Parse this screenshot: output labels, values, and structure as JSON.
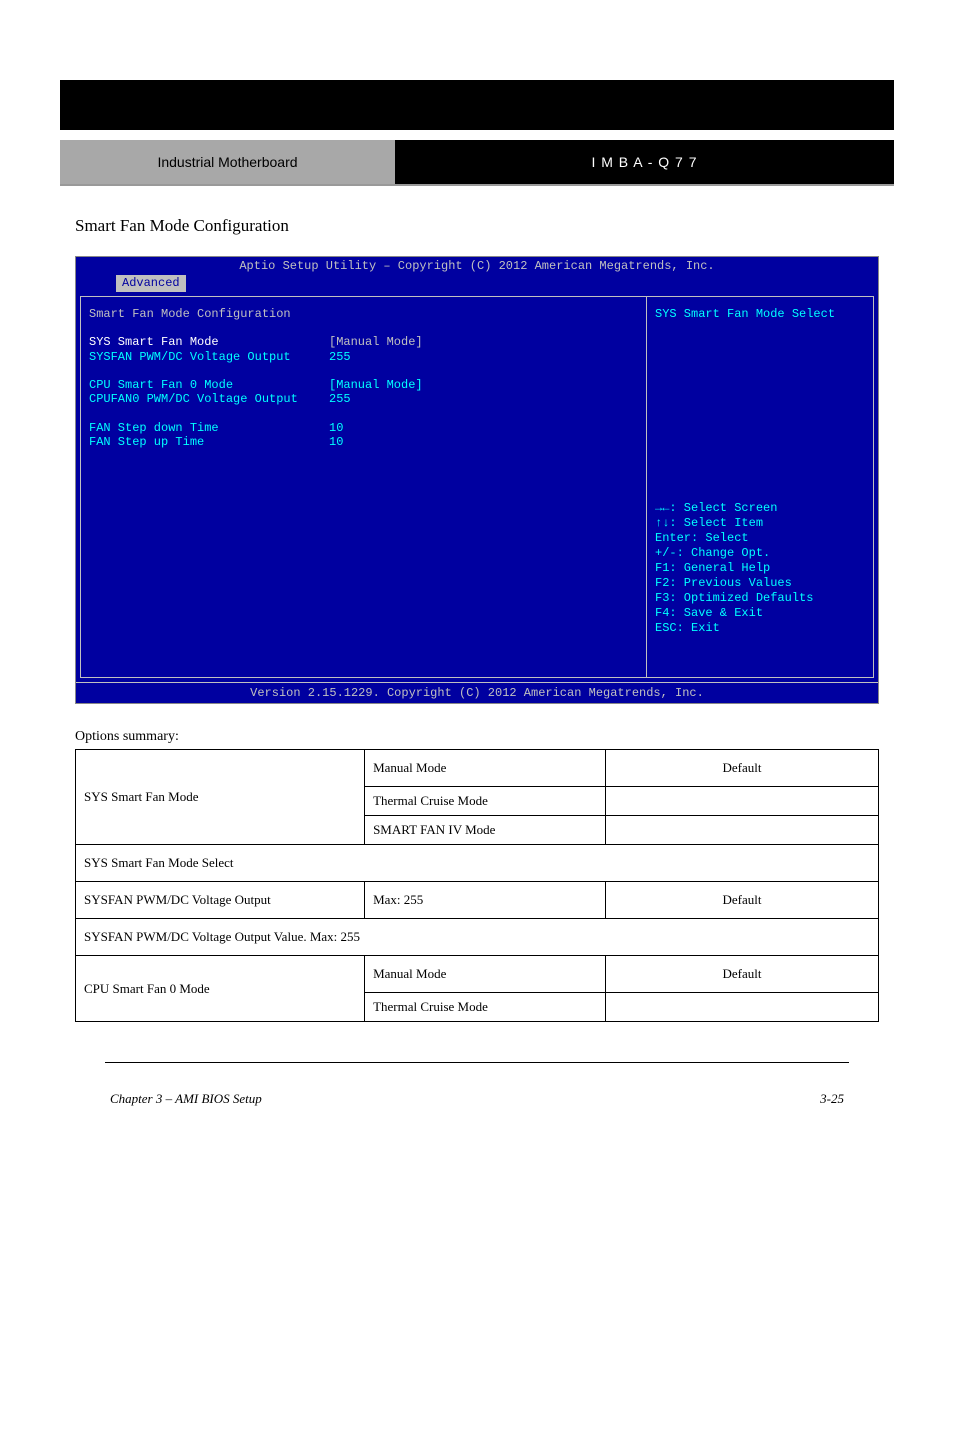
{
  "header": {
    "left": "Industrial Motherboard",
    "right_code": "I M B A - Q 7 7"
  },
  "section_title": "Smart Fan Mode Configuration",
  "bios": {
    "top_bar": "Aptio Setup Utility – Copyright (C) 2012 American Megatrends, Inc.",
    "tab": "Advanced",
    "main_heading": "Smart Fan Mode Configuration",
    "rows": [
      {
        "label": "SYS Smart Fan Mode",
        "value": "[Manual Mode]",
        "label_class": "white",
        "value_class": ""
      },
      {
        "label": "SYSFAN PWM/DC Voltage Output",
        "value": "255",
        "label_class": "cyan",
        "value_class": "cyan"
      },
      {
        "spacer": true
      },
      {
        "label": "CPU Smart Fan 0 Mode",
        "value": "[Manual Mode]",
        "label_class": "cyan",
        "value_class": "cyan"
      },
      {
        "label": "CPUFAN0 PWM/DC Voltage Output",
        "value": "255",
        "label_class": "cyan",
        "value_class": "cyan"
      },
      {
        "spacer": true
      },
      {
        "label": "FAN Step down Time",
        "value": "10",
        "label_class": "cyan",
        "value_class": "cyan"
      },
      {
        "label": "FAN Step up Time",
        "value": "10",
        "label_class": "cyan",
        "value_class": "cyan"
      }
    ],
    "side_desc": "SYS Smart Fan Mode Select",
    "help": [
      "→←: Select Screen",
      "↑↓: Select Item",
      "Enter: Select",
      "+/-: Change Opt.",
      "F1: General Help",
      "F2: Previous Values",
      "F3: Optimized Defaults",
      "F4: Save & Exit",
      "ESC: Exit"
    ],
    "bottom_bar": "Version 2.15.1229. Copyright (C) 2012 American Megatrends, Inc."
  },
  "options_label": "Options summary:",
  "table": {
    "block1": {
      "setting": "SYS Smart Fan Mode",
      "rows": [
        {
          "option": "Manual Mode",
          "default": "Default"
        },
        {
          "option": "Thermal Cruise Mode",
          "default": ""
        },
        {
          "option": "SMART FAN IV Mode",
          "default": ""
        }
      ],
      "desc": "SYS Smart Fan Mode Select"
    },
    "block2": {
      "setting": "SYSFAN PWM/DC Voltage Output",
      "rows": [
        {
          "option": "Max: 255",
          "default": "Default"
        }
      ],
      "desc": "SYSFAN PWM/DC Voltage Output Value. Max: 255"
    },
    "block3": {
      "setting": "CPU Smart Fan 0 Mode",
      "rows": [
        {
          "option": "Manual Mode",
          "default": "Default"
        },
        {
          "option": "Thermal Cruise Mode",
          "default": ""
        }
      ]
    }
  },
  "footer": {
    "left": "Chapter 3 – AMI BIOS Setup",
    "right": "3-25"
  }
}
